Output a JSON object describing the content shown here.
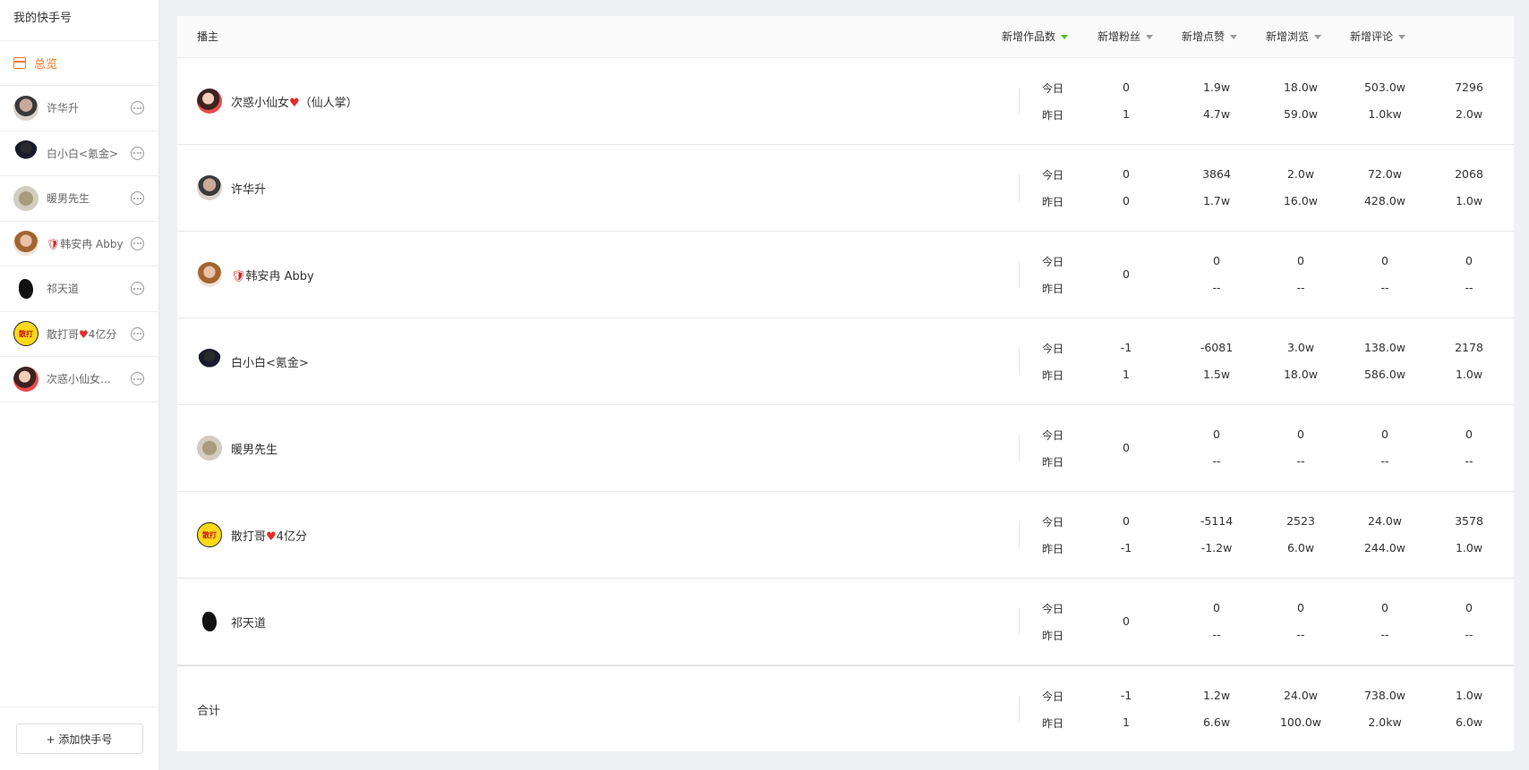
{
  "sidebar": {
    "title": "我的快手号",
    "overview": "总览",
    "accounts": [
      {
        "name": "许华升",
        "avatar": "person"
      },
      {
        "name": "白小白<氪金>",
        "avatar": "boy"
      },
      {
        "name": "暖男先生",
        "avatar": "cat"
      },
      {
        "name": "韩安冉 Abby",
        "prefix": "🛡",
        "avatar": "girl"
      },
      {
        "name": "祁天道",
        "avatar": "ink"
      },
      {
        "name": "散打哥",
        "suffix": "4亿分",
        "avatar": "yellow"
      },
      {
        "name": "次惑小仙女…",
        "avatar": "girl2"
      }
    ],
    "add_button": "+ 添加快手号"
  },
  "table": {
    "header": {
      "streamer": "播主",
      "new_works": "新增作品数",
      "new_fans": "新增粉丝",
      "new_likes": "新增点赞",
      "new_views": "新增浏览",
      "new_comments": "新增评论"
    },
    "today_label": "今日",
    "yesterday_label": "昨日",
    "rows": [
      {
        "name": "次惑小仙女",
        "name_suffix": "（仙人掌）",
        "works_today": "0",
        "works_yesterday": "1",
        "fans_today": "1.9w",
        "fans_yesterday": "4.7w",
        "likes_today": "18.0w",
        "likes_yesterday": "59.0w",
        "views_today": "503.0w",
        "views_yesterday": "1.0kw",
        "comments_today": "7296",
        "comments_yesterday": "2.0w"
      },
      {
        "name": "许华升",
        "works_today": "0",
        "works_yesterday": "0",
        "fans_today": "3864",
        "fans_yesterday": "1.7w",
        "likes_today": "2.0w",
        "likes_yesterday": "16.0w",
        "views_today": "72.0w",
        "views_yesterday": "428.0w",
        "comments_today": "2068",
        "comments_yesterday": "1.0w"
      },
      {
        "name": "韩安冉 Abby",
        "works": "0",
        "fans_today": "0",
        "fans_yesterday": "--",
        "likes_today": "0",
        "likes_yesterday": "--",
        "views_today": "0",
        "views_yesterday": "--",
        "comments_today": "0",
        "comments_yesterday": "--"
      },
      {
        "name": "白小白<氪金>",
        "works_today": "-1",
        "works_yesterday": "1",
        "fans_today": "-6081",
        "fans_yesterday": "1.5w",
        "likes_today": "3.0w",
        "likes_yesterday": "18.0w",
        "views_today": "138.0w",
        "views_yesterday": "586.0w",
        "comments_today": "2178",
        "comments_yesterday": "1.0w"
      },
      {
        "name": "暖男先生",
        "works": "0",
        "fans_today": "0",
        "fans_yesterday": "--",
        "likes_today": "0",
        "likes_yesterday": "--",
        "views_today": "0",
        "views_yesterday": "--",
        "comments_today": "0",
        "comments_yesterday": "--"
      },
      {
        "name": "散打哥",
        "name_suffix": "4亿分",
        "works_today": "0",
        "works_yesterday": "-1",
        "fans_today": "-5114",
        "fans_yesterday": "-1.2w",
        "likes_today": "2523",
        "likes_yesterday": "6.0w",
        "views_today": "24.0w",
        "views_yesterday": "244.0w",
        "comments_today": "3578",
        "comments_yesterday": "1.0w"
      },
      {
        "name": "祁天道",
        "works": "0",
        "fans_today": "0",
        "fans_yesterday": "--",
        "likes_today": "0",
        "likes_yesterday": "--",
        "views_today": "0",
        "views_yesterday": "--",
        "comments_today": "0",
        "comments_yesterday": "--"
      }
    ],
    "total": {
      "label": "合计",
      "works_today": "-1",
      "works_yesterday": "1",
      "fans_today": "1.2w",
      "fans_yesterday": "6.6w",
      "likes_today": "24.0w",
      "likes_yesterday": "100.0w",
      "views_today": "738.0w",
      "views_yesterday": "2.0kw",
      "comments_today": "1.0w",
      "comments_yesterday": "6.0w"
    }
  },
  "colors": {
    "accent": "#ff7a22",
    "sort_active": "#52c41a"
  },
  "icons": [
    "calendar-icon",
    "more-icon",
    "caret-down-icon",
    "heart-icon",
    "badge-icon"
  ]
}
